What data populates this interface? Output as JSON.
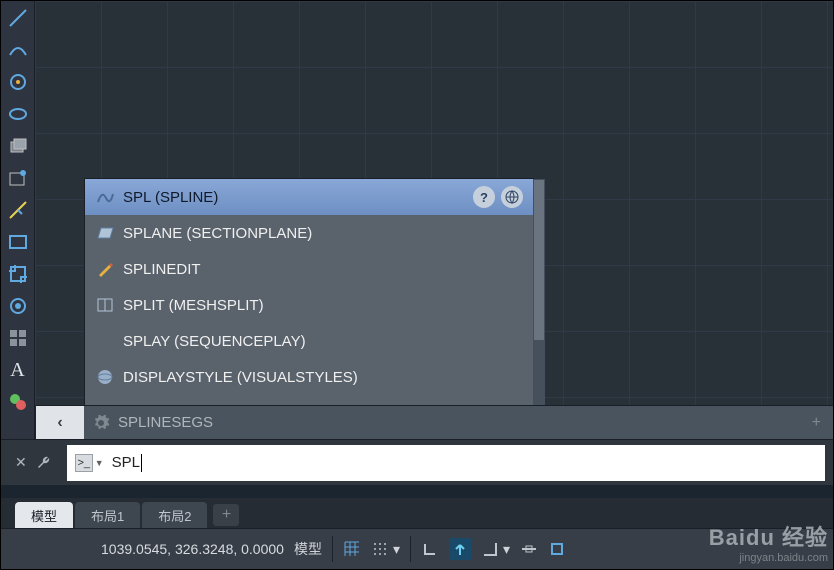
{
  "toolbar": {
    "tools": [
      "line",
      "arc",
      "circle",
      "ellipse",
      "box",
      "polygon",
      "measure",
      "rectangle",
      "crop",
      "camera",
      "grid",
      "text",
      "color"
    ]
  },
  "autocomplete": {
    "items": [
      {
        "label": "SPL (SPLINE)",
        "icon": "spline"
      },
      {
        "label": "SPLANE (SECTIONPLANE)",
        "icon": "plane"
      },
      {
        "label": "SPLINEDIT",
        "icon": "pencil"
      },
      {
        "label": "SPLIT (MESHSPLIT)",
        "icon": "split"
      },
      {
        "label": "SPLAY (SEQUENCEPLAY)",
        "icon": ""
      },
      {
        "label": "DISPLAYSTYLE (VISUALSTYLES)",
        "icon": "globe"
      }
    ],
    "selected_index": 0
  },
  "expand": {
    "text": "SPLINESEGS"
  },
  "command": {
    "value": "SPL"
  },
  "tabs": {
    "items": [
      "模型",
      "布局1",
      "布局2"
    ],
    "active_index": 0
  },
  "status": {
    "coords": "1039.0545, 326.3248, 0.0000",
    "model_label": "模型"
  },
  "watermark": {
    "brand": "Baidu 经验",
    "url": "jingyan.baidu.com"
  }
}
